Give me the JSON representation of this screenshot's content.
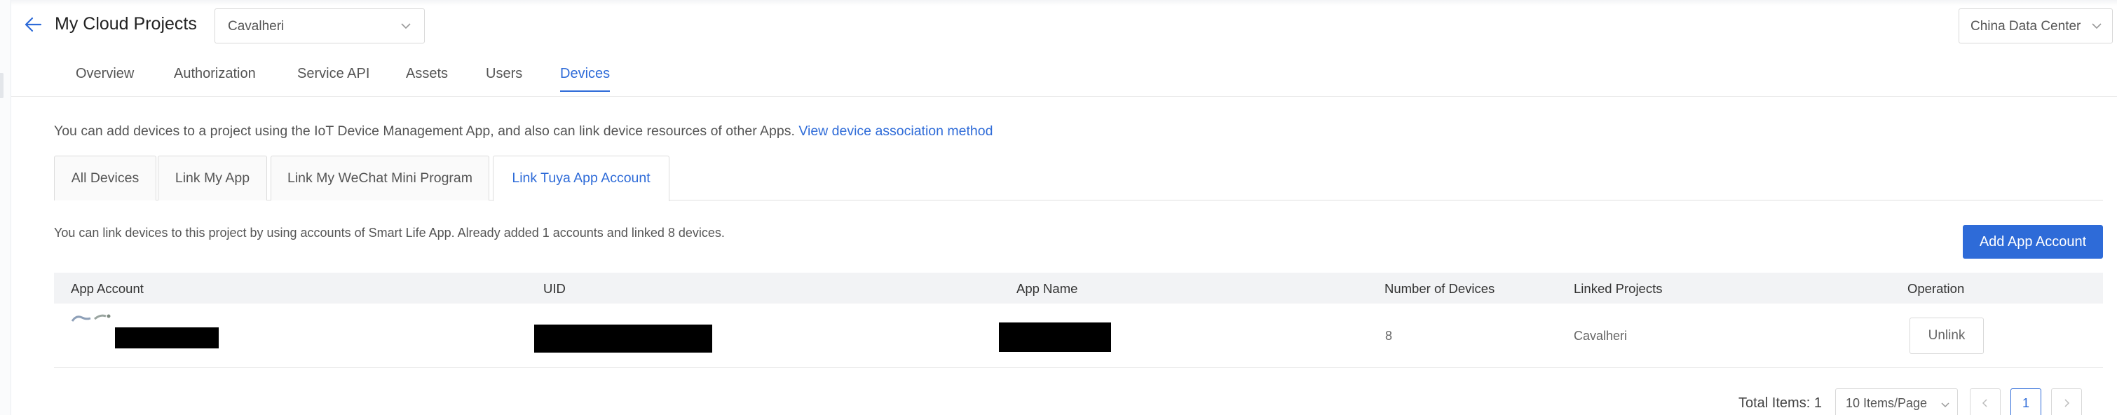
{
  "header": {
    "title": "My Cloud Projects",
    "project_select": "Cavalheri",
    "data_center": "China Data Center"
  },
  "main_tabs": [
    {
      "label": "Overview"
    },
    {
      "label": "Authorization"
    },
    {
      "label": "Service API"
    },
    {
      "label": "Assets"
    },
    {
      "label": "Users"
    },
    {
      "label": "Devices"
    }
  ],
  "description": {
    "text": "You can add devices to a project using the IoT Device Management App, and also can link device resources of other Apps.",
    "link": "View device association method"
  },
  "sub_tabs": [
    {
      "label": "All Devices"
    },
    {
      "label": "Link My App"
    },
    {
      "label": "Link My WeChat Mini Program"
    },
    {
      "label": "Link Tuya App Account"
    }
  ],
  "link_info": "You can link devices to this project by using accounts of Smart Life App. Already added 1 accounts and linked 8 devices.",
  "add_button": "Add App Account",
  "table": {
    "columns": [
      "App Account",
      "UID",
      "App Name",
      "Number of Devices",
      "Linked Projects",
      "Operation"
    ],
    "rows": [
      {
        "devices": "8",
        "linked_project": "Cavalheri",
        "operation": "Unlink"
      }
    ]
  },
  "pagination": {
    "total": "Total Items: 1",
    "per_page": "10 Items/Page",
    "current_page": "1"
  },
  "colors": {
    "accent": "#2e6bd8"
  }
}
